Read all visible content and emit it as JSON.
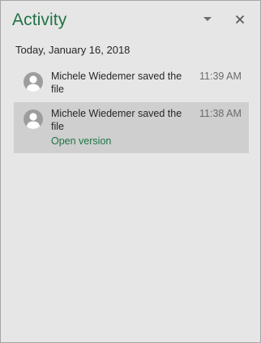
{
  "pane": {
    "title": "Activity",
    "menu_icon": "dropdown-caret-icon",
    "close_icon": "close-icon"
  },
  "groups": [
    {
      "date": "Today, January 16, 2018",
      "entries": [
        {
          "text": "Michele Wiedemer saved the file",
          "time": "11:39 AM",
          "avatar_icon": "person-icon"
        },
        {
          "text": "Michele Wiedemer saved the file",
          "time": "11:38 AM",
          "avatar_icon": "person-icon",
          "link": "Open version",
          "selected": true
        }
      ]
    }
  ],
  "colors": {
    "accent": "#217346",
    "background": "#e6e6e6",
    "selected_row": "#cfcfcf"
  }
}
